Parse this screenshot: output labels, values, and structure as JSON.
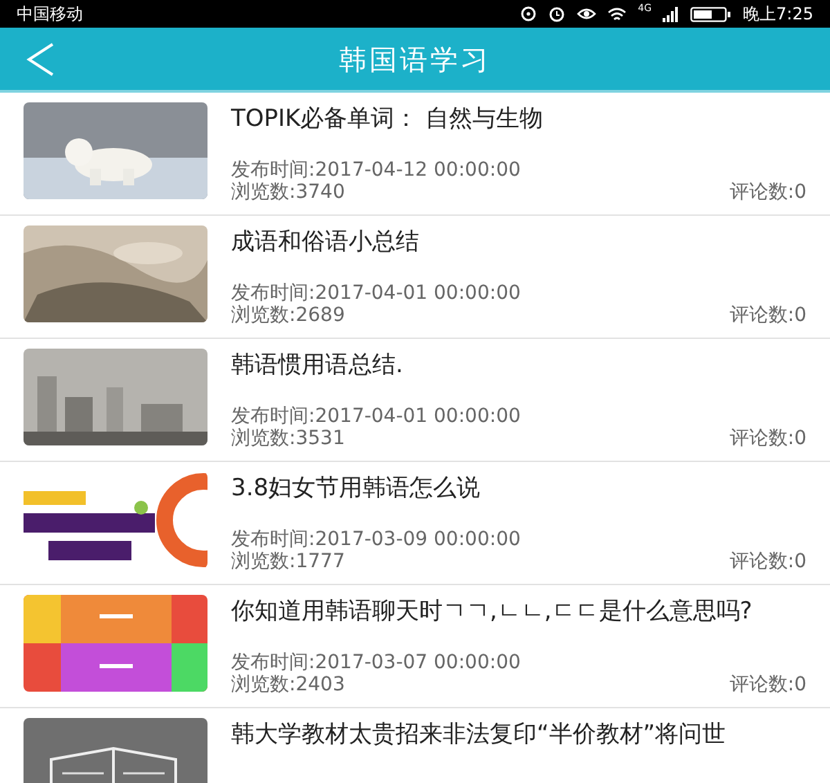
{
  "status_bar": {
    "carrier": "中国移动",
    "network": "4G",
    "time": "晚上7:25"
  },
  "header": {
    "title": "韩国语学习"
  },
  "articles": [
    {
      "title": "TOPIK必备单词： 自然与生物",
      "date": "发布时间:2017-04-12 00:00:00",
      "views": "浏览数:3740",
      "comments": "评论数:0"
    },
    {
      "title": "成语和俗语小总结",
      "date": "发布时间:2017-04-01 00:00:00",
      "views": "浏览数:2689",
      "comments": "评论数:0"
    },
    {
      "title": "韩语惯用语总结.",
      "date": "发布时间:2017-04-01 00:00:00",
      "views": "浏览数:3531",
      "comments": "评论数:0"
    },
    {
      "title": "3.8妇女节用韩语怎么说",
      "date": "发布时间:2017-03-09 00:00:00",
      "views": "浏览数:1777",
      "comments": "评论数:0"
    },
    {
      "title": "你知道用韩语聊天时ㄱㄱ,ㄴㄴ,ㄷㄷ是什么意思吗?",
      "date": "发布时间:2017-03-07 00:00:00",
      "views": "浏览数:2403",
      "comments": "评论数:0"
    },
    {
      "title": "韩大学教材太贵招来非法复印“半价教材”将问世"
    }
  ]
}
